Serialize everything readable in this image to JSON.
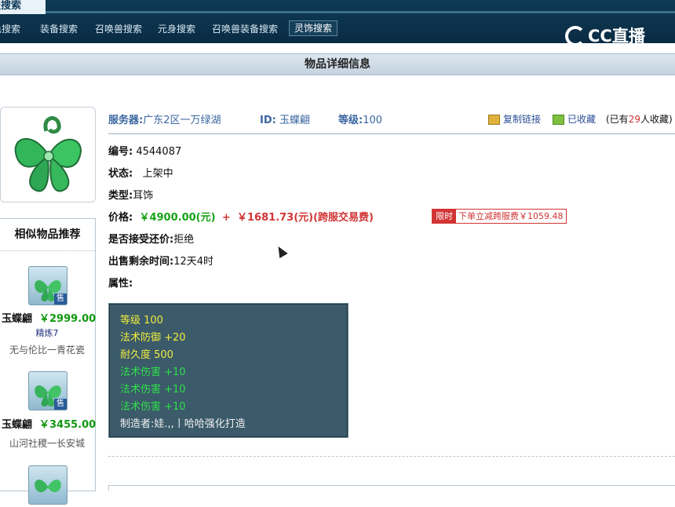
{
  "top_tab": {
    "label": "服搜索"
  },
  "nav": [
    {
      "label": "色搜索"
    },
    {
      "label": "装备搜索"
    },
    {
      "label": "召唤兽搜索"
    },
    {
      "label": "元身搜索"
    },
    {
      "label": "召唤兽装备搜索"
    },
    {
      "label": "灵饰搜索",
      "active": true
    }
  ],
  "logo": {
    "text": "CC直播"
  },
  "section": {
    "title": "物品详细信息"
  },
  "info_header": {
    "server_label": "服务器:",
    "server_value": "广东2区一万绿湖",
    "id_label": "ID:",
    "id_value": "玉蝶翩",
    "level_label": "等级:",
    "level_value": "100",
    "copy_link": "复制链接",
    "favorited": "已收藏",
    "fav_prefix": "(已有",
    "fav_count": "29",
    "fav_suffix": "人收藏)"
  },
  "details": {
    "code_label": "编号:",
    "code_value": "4544087",
    "status_label": "状态:",
    "status_value": "上架中",
    "type_label": "类型:",
    "type_value": "耳饰",
    "price_label": "价格:",
    "price_main": "￥4900.00(元)",
    "price_plus": "+",
    "price_fee": "￥1681.73(元)(跨服交易费)",
    "limit_tag": "限时",
    "limit_msg": "下单立减跨服费￥1059.48",
    "bargain_label": "是否接受还价:",
    "bargain_value": "拒绝",
    "remain_label": "出售剩余时间:",
    "remain_value": "12天4时",
    "attr_label": "属性:"
  },
  "attributes": {
    "lines": [
      {
        "text": "等级 100",
        "color": "yellow"
      },
      {
        "text": "法术防御 +20",
        "color": "yellow"
      },
      {
        "text": "耐久度 500",
        "color": "yellow"
      },
      {
        "text": "法术伤害 +10",
        "color": "green"
      },
      {
        "text": "法术伤害 +10",
        "color": "green"
      },
      {
        "text": "法术伤害 +10",
        "color": "green"
      },
      {
        "text": "制造者:娃.,,丨哈哈强化打造",
        "color": "white"
      }
    ]
  },
  "similar": {
    "title": "相似物品推荐",
    "items": [
      {
        "name": "玉蝶翩",
        "price": "￥2999.00",
        "sub": "精炼7",
        "server": "无与伦比一青花瓷",
        "badge": "售"
      },
      {
        "name": "玉蝶翩",
        "price": "￥3455.00",
        "sub": "",
        "server": "山河社稷一长安城",
        "badge": "售"
      }
    ]
  },
  "colors": {
    "topbar": "#0e3a55",
    "price_green": "#17a317",
    "price_red": "#d23434",
    "link_blue": "#3b66a0",
    "attr_bg": "#3b5a6a"
  }
}
